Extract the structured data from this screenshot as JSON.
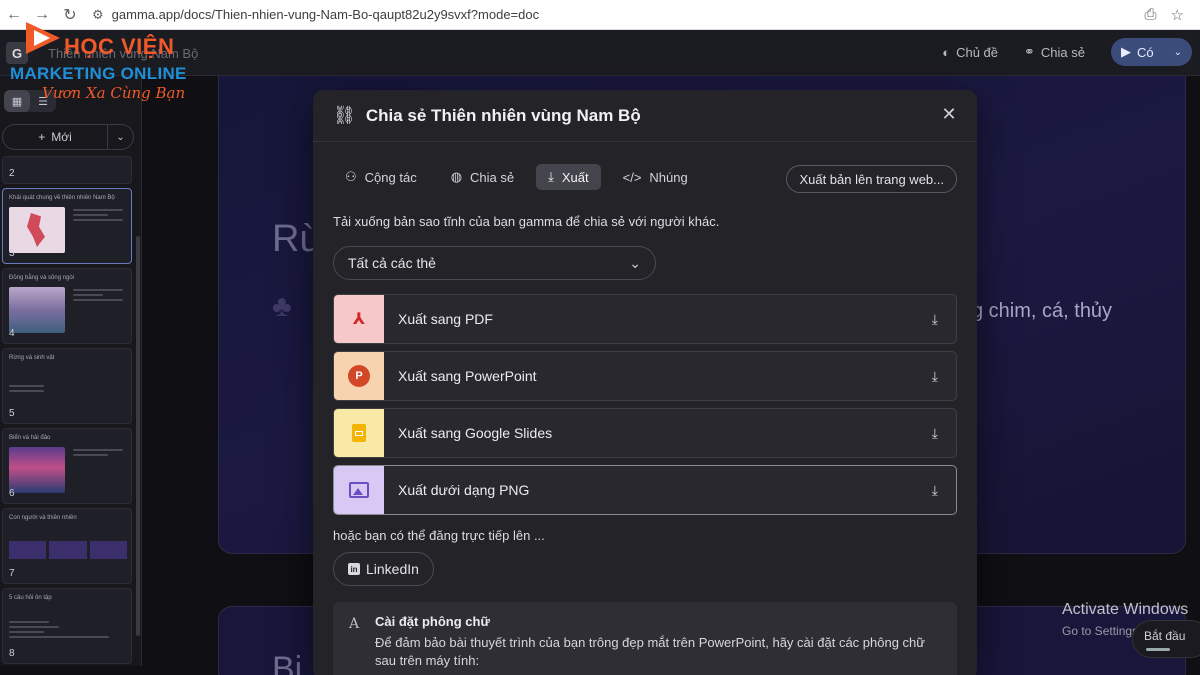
{
  "browser": {
    "url": "gamma.app/docs/Thien-nhien-vung-Nam-Bo-qaupt82u2y9svxf?mode=doc"
  },
  "brand": {
    "line1": "HỌC VIỆN",
    "line2": "MARKETING ONLINE",
    "line3": "Vươn Xa Cùng Bạn"
  },
  "app_bar": {
    "doc_title": "Thiên nhiên vùng Nam Bộ",
    "theme_label": "Chủ đề",
    "share_label": "Chia sẻ",
    "present_label": "Có"
  },
  "sidebar": {
    "new_label": "Mới",
    "thumbs": [
      {
        "num": "2",
        "title": ""
      },
      {
        "num": "3",
        "title": "Khái quát chung về thiên nhiên Nam Bộ"
      },
      {
        "num": "4",
        "title": "Đồng bằng và sông ngòi"
      },
      {
        "num": "5",
        "title": "Rừng và sinh vật"
      },
      {
        "num": "6",
        "title": "Biển và hải đảo"
      },
      {
        "num": "7",
        "title": "Con người và thiên nhiên"
      },
      {
        "num": "8",
        "title": "5 câu hỏi ôn tập"
      }
    ]
  },
  "background": {
    "heading": "Rừ",
    "text": "g chim, cá, thủy",
    "heading2": "Bi"
  },
  "modal": {
    "title": "Chia sẻ Thiên nhiên vùng Nam Bộ",
    "tabs": [
      {
        "label": "Cộng tác",
        "icon": "add-user-icon"
      },
      {
        "label": "Chia sẻ",
        "icon": "globe-icon"
      },
      {
        "label": "Xuất",
        "icon": "download-icon"
      },
      {
        "label": "Nhúng",
        "icon": "code-icon"
      }
    ],
    "publish_label": "Xuất bản lên trang web...",
    "description": "Tải xuống bản sao tĩnh của bạn gamma để chia sẻ với người khác.",
    "select_value": "Tất cả các thẻ",
    "exports": [
      {
        "label": "Xuất sang PDF",
        "icon": "pdf-icon",
        "color": "#f6c8c8"
      },
      {
        "label": "Xuất sang PowerPoint",
        "icon": "powerpoint-icon",
        "color": "#f8d3b0"
      },
      {
        "label": "Xuất sang Google Slides",
        "icon": "google-slides-icon",
        "color": "#f8e9a6"
      },
      {
        "label": "Xuất dưới dạng PNG",
        "icon": "image-icon",
        "color": "#d7c8f4"
      }
    ],
    "or_text": "hoặc bạn có thể đăng trực tiếp lên ...",
    "linkedin_label": "LinkedIn",
    "font_settings": {
      "title": "Cài đặt phông chữ",
      "body": "Để đảm bảo bài thuyết trình của bạn trông đẹp mắt trên PowerPoint, hãy cài đặt các phông chữ sau trên máy tính:"
    }
  },
  "windows": {
    "activate": "Activate Windows",
    "activate_sub": "Go to Settings to activate",
    "start": "Bắt đầu"
  }
}
